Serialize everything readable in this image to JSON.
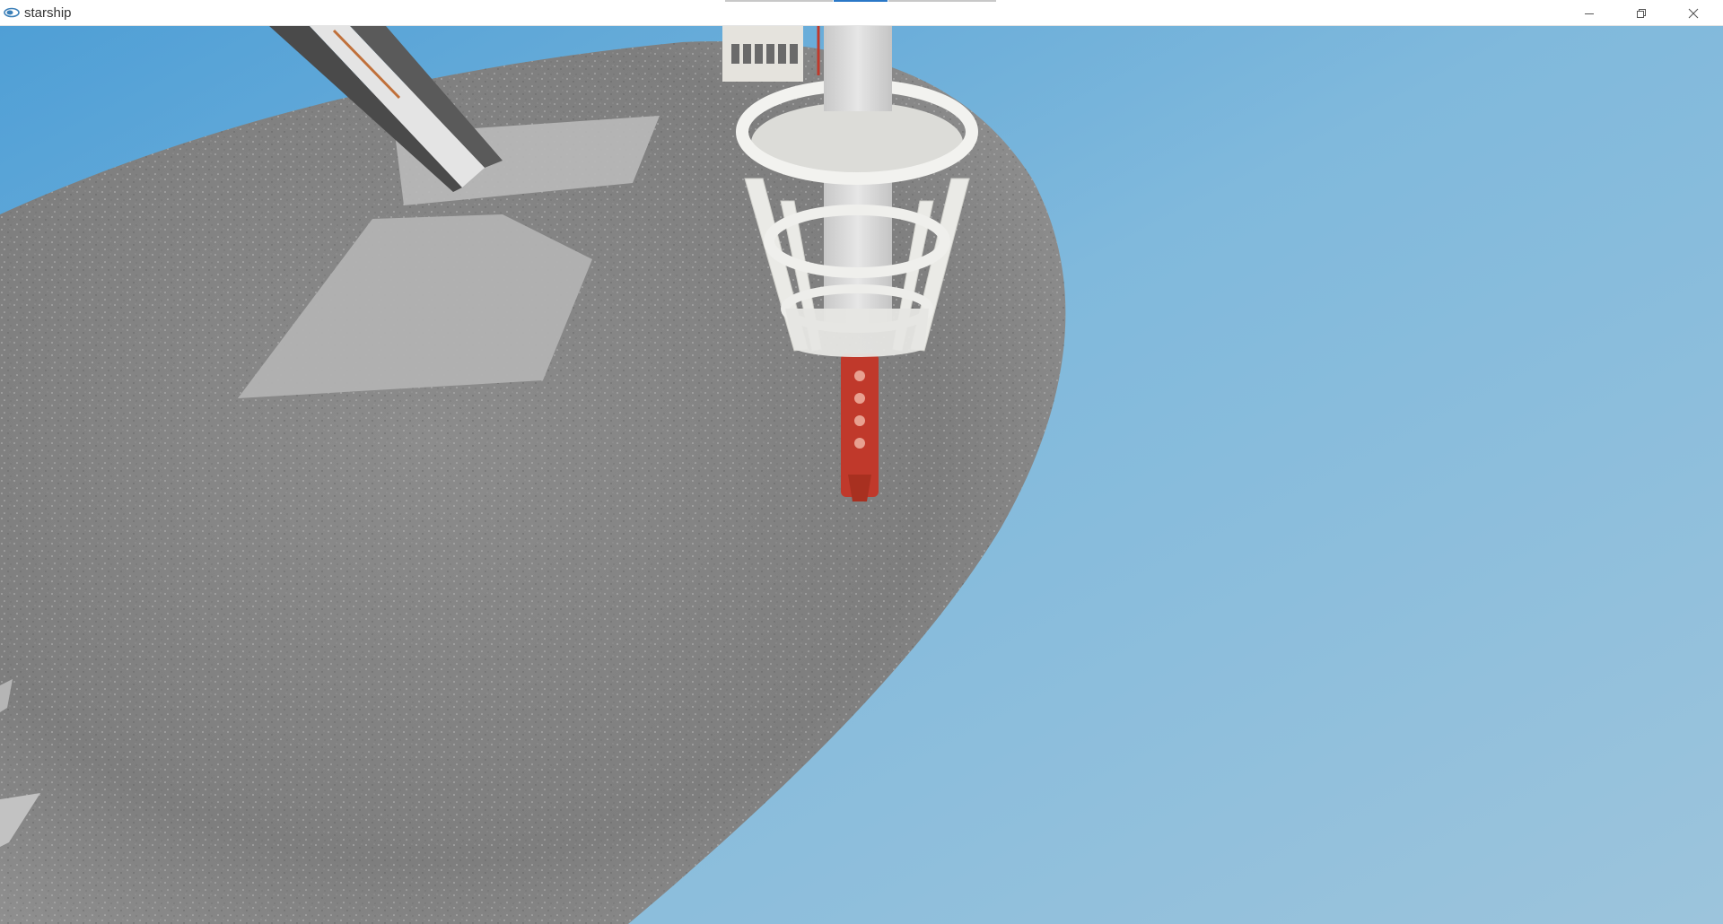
{
  "window": {
    "title": "starship",
    "app_icon": "starship-app-icon",
    "controls": {
      "minimize_icon": "minimize-icon",
      "restore_icon": "restore-icon",
      "close_icon": "close-icon"
    }
  },
  "scene": {
    "description_icon": "3d-viewport",
    "colors": {
      "sky": "#7fb4d6",
      "ground": "#8a8a8a",
      "tower_shaft": "#d8d8d8",
      "cage": "#eeeeec",
      "red_strut": "#c0392b"
    }
  }
}
